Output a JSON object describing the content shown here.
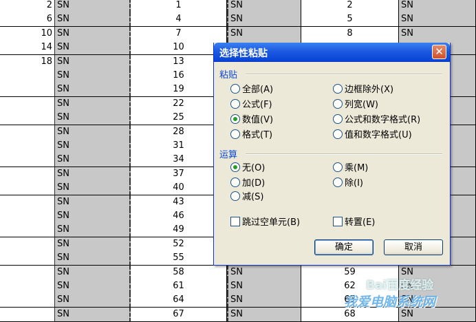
{
  "sheet": {
    "rows": [
      {
        "a": "2",
        "b": "SN",
        "c": "1",
        "d": "SN",
        "e": "2",
        "f": "SN"
      },
      {
        "a": "6",
        "b": "SN",
        "c": "4",
        "d": "SN",
        "e": "5",
        "f": "SN"
      },
      {
        "a": "10",
        "b": "SN",
        "c": "7",
        "d": "SN",
        "e": "8",
        "f": "SN"
      },
      {
        "a": "14",
        "b": "SN",
        "c": "10",
        "d": "",
        "e": "",
        "f": ""
      },
      {
        "a": "18",
        "b": "SN",
        "c": "13",
        "d": "",
        "e": "",
        "f": ""
      },
      {
        "a": "",
        "b": "SN",
        "c": "16",
        "d": "",
        "e": "",
        "f": ""
      },
      {
        "a": "",
        "b": "SN",
        "c": "19",
        "d": "",
        "e": "",
        "f": ""
      },
      {
        "a": "",
        "b": "SN",
        "c": "22",
        "d": "",
        "e": "",
        "f": ""
      },
      {
        "a": "",
        "b": "SN",
        "c": "25",
        "d": "",
        "e": "",
        "f": ""
      },
      {
        "a": "",
        "b": "SN",
        "c": "28",
        "d": "",
        "e": "",
        "f": ""
      },
      {
        "a": "",
        "b": "SN",
        "c": "31",
        "d": "",
        "e": "",
        "f": ""
      },
      {
        "a": "",
        "b": "SN",
        "c": "34",
        "d": "",
        "e": "",
        "f": ""
      },
      {
        "a": "",
        "b": "SN",
        "c": "37",
        "d": "",
        "e": "",
        "f": ""
      },
      {
        "a": "",
        "b": "SN",
        "c": "40",
        "d": "",
        "e": "",
        "f": ""
      },
      {
        "a": "",
        "b": "SN",
        "c": "43",
        "d": "",
        "e": "",
        "f": ""
      },
      {
        "a": "",
        "b": "SN",
        "c": "46",
        "d": "",
        "e": "",
        "f": ""
      },
      {
        "a": "",
        "b": "SN",
        "c": "49",
        "d": "",
        "e": "",
        "f": ""
      },
      {
        "a": "",
        "b": "SN",
        "c": "52",
        "d": "",
        "e": "",
        "f": ""
      },
      {
        "a": "",
        "b": "SN",
        "c": "55",
        "d": "",
        "e": "",
        "f": ""
      },
      {
        "a": "",
        "b": "SN",
        "c": "58",
        "d": "SN",
        "e": "59",
        "f": "SN"
      },
      {
        "a": "",
        "b": "SN",
        "c": "61",
        "d": "SN",
        "e": "62",
        "f": "SN"
      },
      {
        "a": "",
        "b": "SN",
        "c": "64",
        "d": "SN",
        "e": "65",
        "f": "SN"
      },
      {
        "a": "",
        "b": "SN",
        "c": "67",
        "d": "SN",
        "e": "68",
        "f": "SN"
      }
    ]
  },
  "dialog": {
    "title": "选择性粘贴",
    "close_label": "✕",
    "paste_section": "粘贴",
    "paste_options": {
      "all": "全部(A)",
      "formulas": "公式(F)",
      "values": "数值(V)",
      "formats": "格式(T)",
      "all_except_borders": "边框除外(X)",
      "column_widths": "列宽(W)",
      "formulas_and_number_formats": "公式和数字格式(R)",
      "values_and_number_formats": "值和数字格式(U)"
    },
    "paste_selected": "values",
    "operation_section": "运算",
    "operation_options": {
      "none": "无(O)",
      "add": "加(D)",
      "subtract": "减(S)",
      "multiply": "乘(M)",
      "divide": "除(I)"
    },
    "operation_selected": "none",
    "skip_blanks_label": "跳过空单元(B)",
    "transpose_label": "转置(E)",
    "ok_label": "确定",
    "cancel_label": "取消"
  },
  "watermark": {
    "line1": "Bai百度经验",
    "line2": "我爱电脑系统网"
  },
  "colors": {
    "titlebar": "#0a46d8",
    "dialog_bg": "#ece9d8",
    "selected_radio": "#21a121",
    "shaded_cell": "#c8c8c8"
  }
}
